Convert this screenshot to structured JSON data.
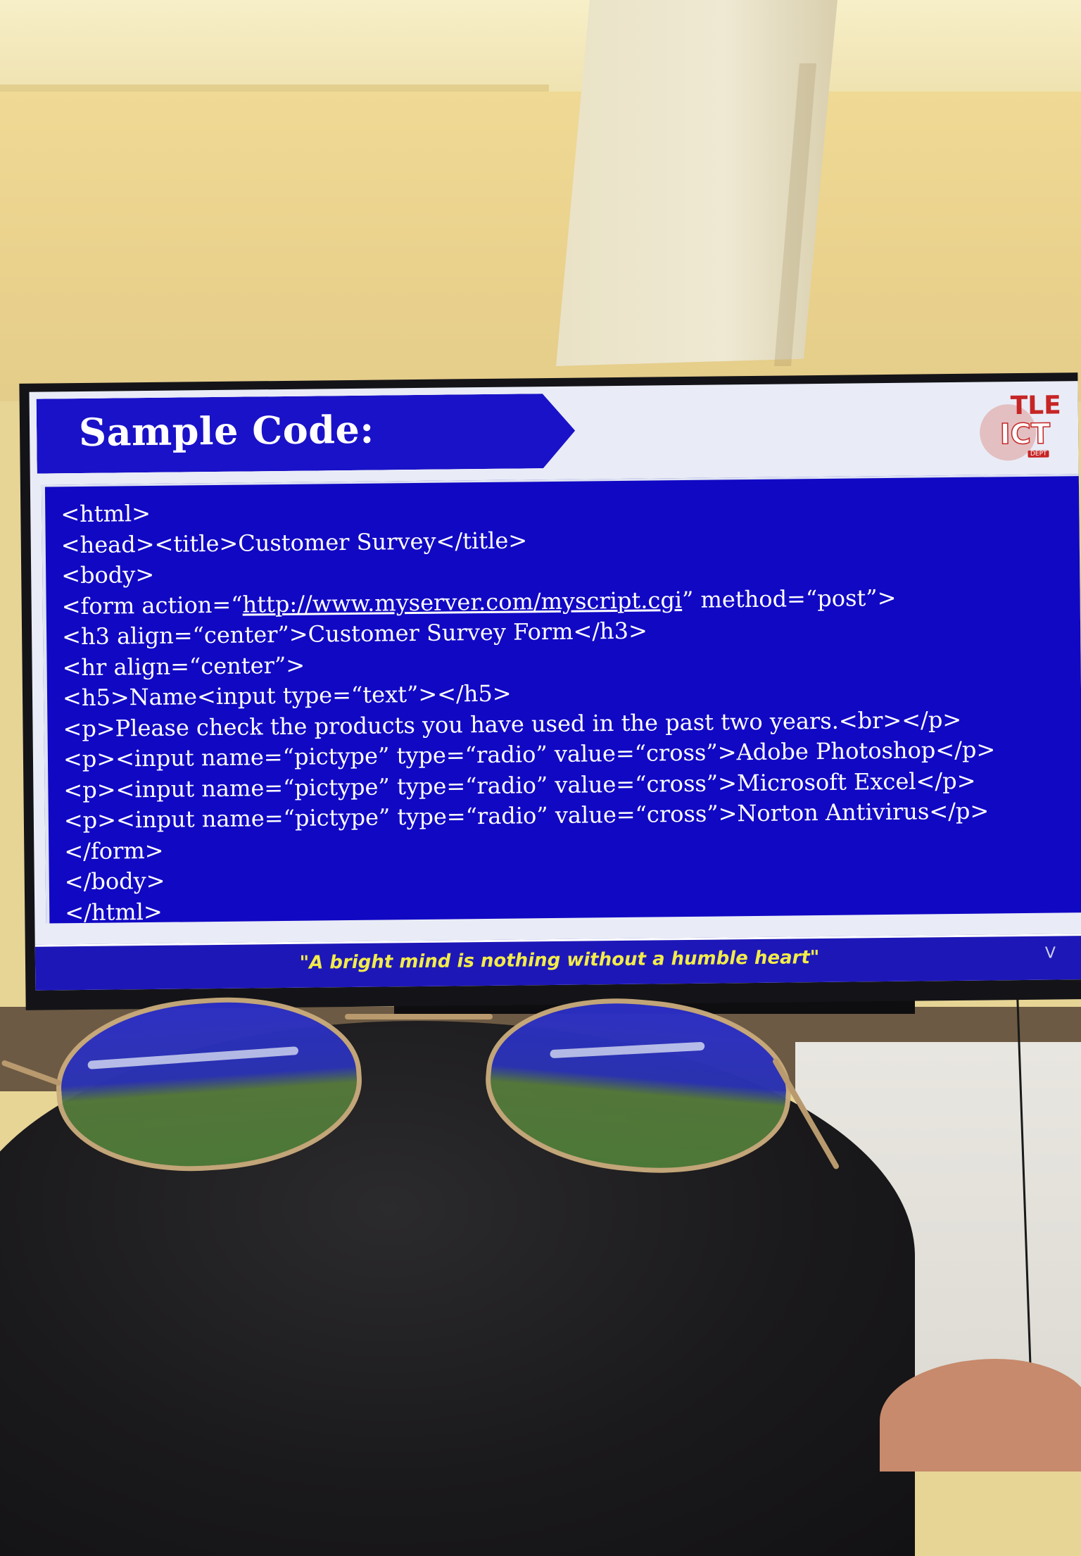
{
  "slide": {
    "title": "Sample Code:",
    "logo": {
      "line1": "TLE",
      "line2": "ICT",
      "line3": "DEPT",
      "colors": {
        "primary": "#c62525",
        "secondary": "#ffffff"
      }
    },
    "code_lines": [
      "<html>",
      "<head><title>Customer Survey</title>",
      "<body>",
      "<form action=“http://www.myserver.com/myscript.cgi” method=“post”>",
      "<h3 align=“center”>Customer Survey Form</h3>",
      "<hr align=“center”>",
      "<h5>Name<input type=“text”></h5>",
      "<p>Please check the products you have used in the past two years.<br></p>",
      "<p><input name=“pictype” type=“radio” value=“cross”>Adobe Photoshop</p>",
      "<p><input name=“pictype” type=“radio” value=“cross”>Microsoft Excel</p>",
      "<p><input name=“pictype” type=“radio” value=“cross”>Norton Antivirus</p>",
      "</form>",
      "</body>",
      "</html>"
    ],
    "footer_quote": "\"A bright mind is nothing without a humble heart\"",
    "footer_mark": "V",
    "colors": {
      "banner": "#1a12c8",
      "code_panel": "#1108c4",
      "code_text": "#ffffff",
      "footer_text": "#f2ec4a"
    }
  }
}
